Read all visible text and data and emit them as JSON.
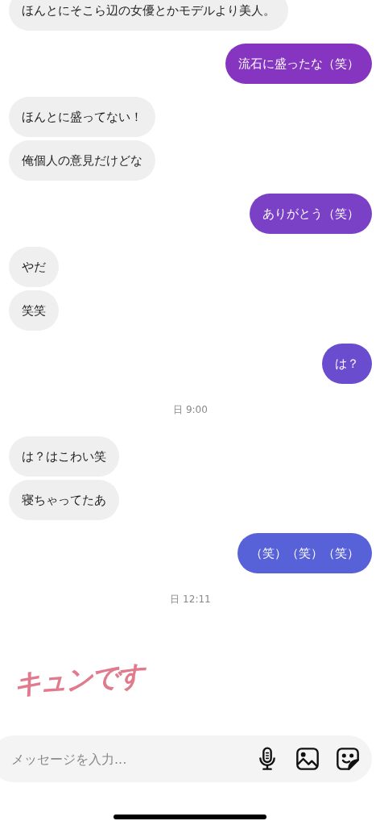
{
  "messages": [
    {
      "kind": "incoming",
      "text": "ほんとにそこら辺の女優とかモデルより美人。"
    },
    {
      "kind": "outgoing",
      "text": "流石に盛ったな（笑）",
      "color": "#8535bf"
    },
    {
      "kind": "incoming",
      "text": "ほんとに盛ってない！"
    },
    {
      "kind": "incoming",
      "text": "俺個人の意見だけどな"
    },
    {
      "kind": "outgoing",
      "text": "ありがとう（笑）",
      "color": "#7a40c6"
    },
    {
      "kind": "incoming",
      "text": "やだ"
    },
    {
      "kind": "incoming",
      "text": "笑笑"
    },
    {
      "kind": "outgoing",
      "text": "は？",
      "color": "#6a4ccf"
    },
    {
      "kind": "timestamp",
      "text": "日 9:00"
    },
    {
      "kind": "incoming",
      "text": "は？はこわい笑"
    },
    {
      "kind": "incoming",
      "text": "寝ちゃってたあ"
    },
    {
      "kind": "outgoing",
      "text": "（笑）（笑）（笑）",
      "color": "#5762d8"
    },
    {
      "kind": "timestamp",
      "text": "日 12:11"
    },
    {
      "kind": "sticker",
      "text": "キュンです"
    }
  ],
  "composer": {
    "placeholder": "メッセージを入力..."
  }
}
